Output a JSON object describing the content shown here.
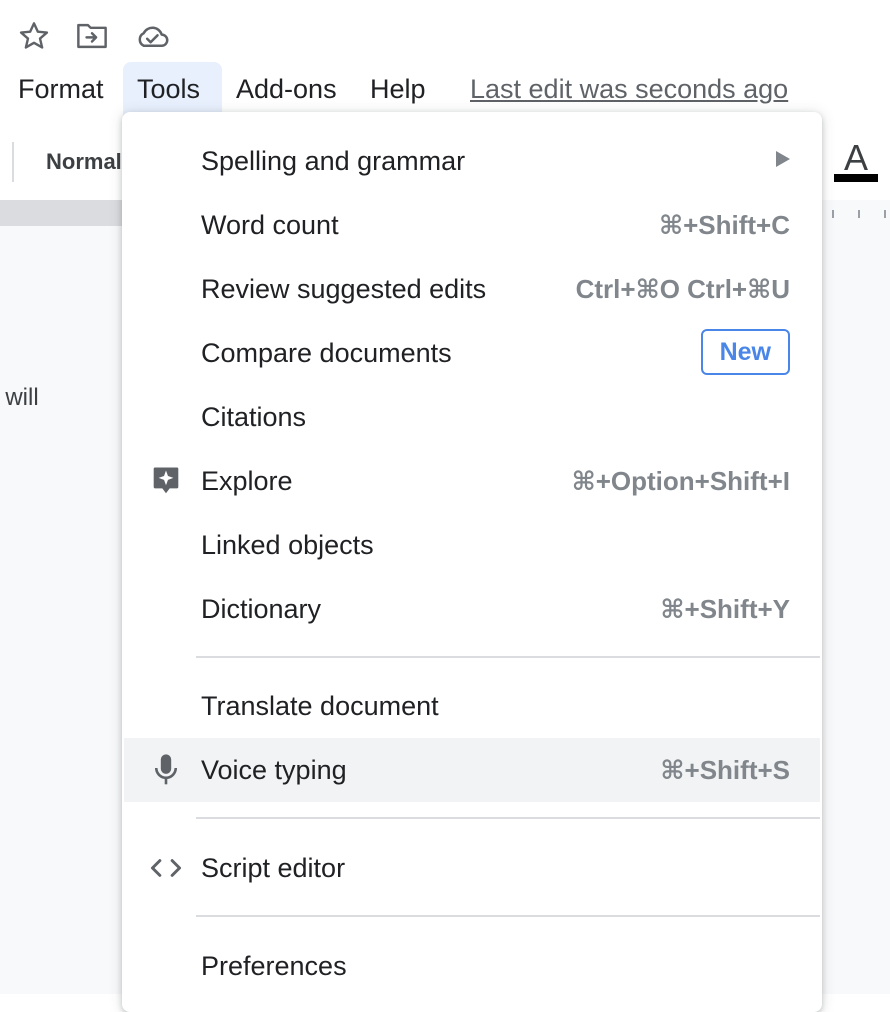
{
  "top_icons": [
    "star-icon",
    "move-to-folder-icon",
    "cloud-saved-icon"
  ],
  "menubar": {
    "items": [
      {
        "label": "Format"
      },
      {
        "label": "Tools"
      },
      {
        "label": "Add-ons"
      },
      {
        "label": "Help"
      }
    ],
    "active": "Tools",
    "last_edit": "Last edit was seconds ago"
  },
  "toolbar": {
    "style_value": "Normal",
    "text_color_letter": "A",
    "text_color": "#000000"
  },
  "document": {
    "visible_text": "t will"
  },
  "tools_menu": {
    "items": [
      {
        "label": "Spelling and grammar",
        "submenu": true
      },
      {
        "label": "Word count",
        "shortcut": "⌘+Shift+C"
      },
      {
        "label": "Review suggested edits",
        "shortcut": "Ctrl+⌘O Ctrl+⌘U"
      },
      {
        "label": "Compare documents",
        "badge": "New"
      },
      {
        "label": "Citations"
      },
      {
        "label": "Explore",
        "shortcut": "⌘+Option+Shift+I",
        "icon": "explore-icon"
      },
      {
        "label": "Linked objects"
      },
      {
        "label": "Dictionary",
        "shortcut": "⌘+Shift+Y"
      },
      {
        "label": "Translate document"
      },
      {
        "label": "Voice typing",
        "shortcut": "⌘+Shift+S",
        "icon": "microphone-icon",
        "highlighted": true
      },
      {
        "label": "Script editor",
        "icon": "code-icon"
      },
      {
        "label": "Preferences"
      }
    ]
  },
  "colors": {
    "accent_blue": "#4a86e8",
    "menu_active_bg": "#e8f0fe",
    "hover_bg": "#f1f3f4"
  }
}
